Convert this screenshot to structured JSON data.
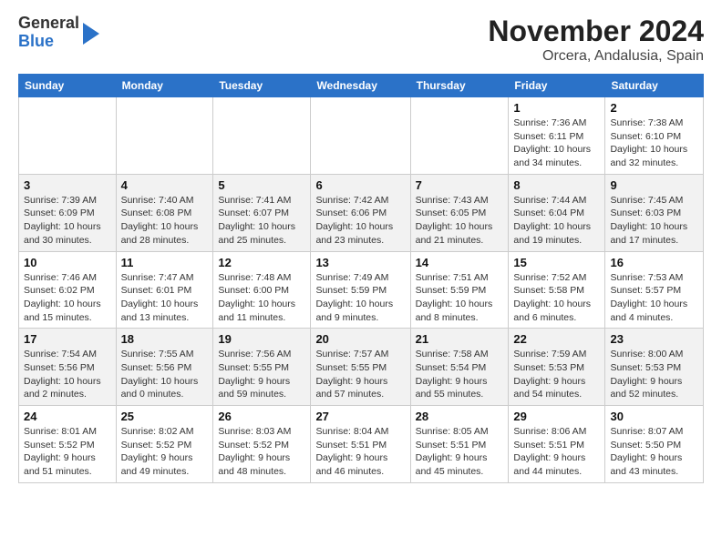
{
  "header": {
    "logo_general": "General",
    "logo_blue": "Blue",
    "title": "November 2024",
    "subtitle": "Orcera, Andalusia, Spain"
  },
  "calendar": {
    "weekdays": [
      "Sunday",
      "Monday",
      "Tuesday",
      "Wednesday",
      "Thursday",
      "Friday",
      "Saturday"
    ],
    "weeks": [
      [
        {
          "day": "",
          "info": ""
        },
        {
          "day": "",
          "info": ""
        },
        {
          "day": "",
          "info": ""
        },
        {
          "day": "",
          "info": ""
        },
        {
          "day": "",
          "info": ""
        },
        {
          "day": "1",
          "info": "Sunrise: 7:36 AM\nSunset: 6:11 PM\nDaylight: 10 hours and 34 minutes."
        },
        {
          "day": "2",
          "info": "Sunrise: 7:38 AM\nSunset: 6:10 PM\nDaylight: 10 hours and 32 minutes."
        }
      ],
      [
        {
          "day": "3",
          "info": "Sunrise: 7:39 AM\nSunset: 6:09 PM\nDaylight: 10 hours and 30 minutes."
        },
        {
          "day": "4",
          "info": "Sunrise: 7:40 AM\nSunset: 6:08 PM\nDaylight: 10 hours and 28 minutes."
        },
        {
          "day": "5",
          "info": "Sunrise: 7:41 AM\nSunset: 6:07 PM\nDaylight: 10 hours and 25 minutes."
        },
        {
          "day": "6",
          "info": "Sunrise: 7:42 AM\nSunset: 6:06 PM\nDaylight: 10 hours and 23 minutes."
        },
        {
          "day": "7",
          "info": "Sunrise: 7:43 AM\nSunset: 6:05 PM\nDaylight: 10 hours and 21 minutes."
        },
        {
          "day": "8",
          "info": "Sunrise: 7:44 AM\nSunset: 6:04 PM\nDaylight: 10 hours and 19 minutes."
        },
        {
          "day": "9",
          "info": "Sunrise: 7:45 AM\nSunset: 6:03 PM\nDaylight: 10 hours and 17 minutes."
        }
      ],
      [
        {
          "day": "10",
          "info": "Sunrise: 7:46 AM\nSunset: 6:02 PM\nDaylight: 10 hours and 15 minutes."
        },
        {
          "day": "11",
          "info": "Sunrise: 7:47 AM\nSunset: 6:01 PM\nDaylight: 10 hours and 13 minutes."
        },
        {
          "day": "12",
          "info": "Sunrise: 7:48 AM\nSunset: 6:00 PM\nDaylight: 10 hours and 11 minutes."
        },
        {
          "day": "13",
          "info": "Sunrise: 7:49 AM\nSunset: 5:59 PM\nDaylight: 10 hours and 9 minutes."
        },
        {
          "day": "14",
          "info": "Sunrise: 7:51 AM\nSunset: 5:59 PM\nDaylight: 10 hours and 8 minutes."
        },
        {
          "day": "15",
          "info": "Sunrise: 7:52 AM\nSunset: 5:58 PM\nDaylight: 10 hours and 6 minutes."
        },
        {
          "day": "16",
          "info": "Sunrise: 7:53 AM\nSunset: 5:57 PM\nDaylight: 10 hours and 4 minutes."
        }
      ],
      [
        {
          "day": "17",
          "info": "Sunrise: 7:54 AM\nSunset: 5:56 PM\nDaylight: 10 hours and 2 minutes."
        },
        {
          "day": "18",
          "info": "Sunrise: 7:55 AM\nSunset: 5:56 PM\nDaylight: 10 hours and 0 minutes."
        },
        {
          "day": "19",
          "info": "Sunrise: 7:56 AM\nSunset: 5:55 PM\nDaylight: 9 hours and 59 minutes."
        },
        {
          "day": "20",
          "info": "Sunrise: 7:57 AM\nSunset: 5:55 PM\nDaylight: 9 hours and 57 minutes."
        },
        {
          "day": "21",
          "info": "Sunrise: 7:58 AM\nSunset: 5:54 PM\nDaylight: 9 hours and 55 minutes."
        },
        {
          "day": "22",
          "info": "Sunrise: 7:59 AM\nSunset: 5:53 PM\nDaylight: 9 hours and 54 minutes."
        },
        {
          "day": "23",
          "info": "Sunrise: 8:00 AM\nSunset: 5:53 PM\nDaylight: 9 hours and 52 minutes."
        }
      ],
      [
        {
          "day": "24",
          "info": "Sunrise: 8:01 AM\nSunset: 5:52 PM\nDaylight: 9 hours and 51 minutes."
        },
        {
          "day": "25",
          "info": "Sunrise: 8:02 AM\nSunset: 5:52 PM\nDaylight: 9 hours and 49 minutes."
        },
        {
          "day": "26",
          "info": "Sunrise: 8:03 AM\nSunset: 5:52 PM\nDaylight: 9 hours and 48 minutes."
        },
        {
          "day": "27",
          "info": "Sunrise: 8:04 AM\nSunset: 5:51 PM\nDaylight: 9 hours and 46 minutes."
        },
        {
          "day": "28",
          "info": "Sunrise: 8:05 AM\nSunset: 5:51 PM\nDaylight: 9 hours and 45 minutes."
        },
        {
          "day": "29",
          "info": "Sunrise: 8:06 AM\nSunset: 5:51 PM\nDaylight: 9 hours and 44 minutes."
        },
        {
          "day": "30",
          "info": "Sunrise: 8:07 AM\nSunset: 5:50 PM\nDaylight: 9 hours and 43 minutes."
        }
      ]
    ]
  }
}
